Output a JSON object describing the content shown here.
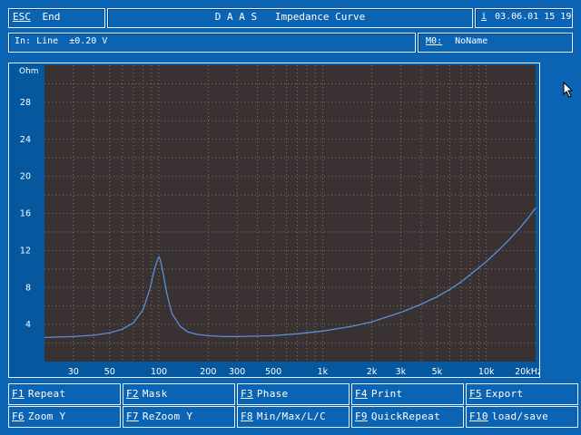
{
  "topbar": {
    "esc_key": "ESC",
    "esc_label": "End",
    "title": "D A A S   Impedance Curve",
    "info_key": "i",
    "datetime": "03.06.01 15 19"
  },
  "infobar": {
    "input": "In: Line  ±0.20 V",
    "mem_label": "M0:",
    "mem_name": "NoName"
  },
  "chart_data": {
    "type": "line",
    "title": "",
    "xlabel": "",
    "ylabel": "Ohm",
    "xscale": "log",
    "xlim": [
      20,
      20000
    ],
    "ylim": [
      0,
      32
    ],
    "xticks": [
      30,
      50,
      100,
      200,
      300,
      500,
      1000,
      2000,
      3000,
      5000,
      10000,
      20000
    ],
    "xtick_labels": [
      "30",
      "50",
      "100",
      "200",
      "300",
      "500",
      "1k",
      "2k",
      "3k",
      "5k",
      "10k",
      "20kHz"
    ],
    "yticks": [
      4,
      8,
      12,
      16,
      20,
      24,
      28
    ],
    "ytick_labels": [
      "4",
      "8",
      "12",
      "16",
      "20",
      "24",
      "28"
    ],
    "grid": true,
    "series": [
      {
        "color": "#5b8fd8",
        "x": [
          20,
          30,
          40,
          50,
          60,
          70,
          80,
          88,
          94,
          98,
          100,
          102,
          106,
          112,
          120,
          135,
          150,
          170,
          200,
          250,
          300,
          400,
          500,
          700,
          1000,
          1500,
          2000,
          3000,
          4000,
          5000,
          6000,
          7000,
          8000,
          10000,
          12000,
          14000,
          16000,
          18000,
          20000
        ],
        "y": [
          2.6,
          2.7,
          2.85,
          3.1,
          3.5,
          4.2,
          5.6,
          7.8,
          10.0,
          11.0,
          11.3,
          11.0,
          9.6,
          7.3,
          5.2,
          3.8,
          3.2,
          2.95,
          2.8,
          2.7,
          2.7,
          2.75,
          2.8,
          3.0,
          3.3,
          3.8,
          4.3,
          5.3,
          6.2,
          7.0,
          7.8,
          8.6,
          9.4,
          10.8,
          12.1,
          13.3,
          14.4,
          15.5,
          16.6
        ]
      }
    ]
  },
  "function_keys": [
    {
      "key": "F1",
      "label": "Repeat"
    },
    {
      "key": "F2",
      "label": "Mask"
    },
    {
      "key": "F3",
      "label": "Phase"
    },
    {
      "key": "F4",
      "label": "Print"
    },
    {
      "key": "F5",
      "label": "Export"
    },
    {
      "key": "F6",
      "label": "Zoom Y"
    },
    {
      "key": "F7",
      "label": "ReZoom Y"
    },
    {
      "key": "F8",
      "label": "Min/Max/L/C"
    },
    {
      "key": "F9",
      "label": "QuickRepeat"
    },
    {
      "key": "F10",
      "label": "load/save"
    }
  ]
}
